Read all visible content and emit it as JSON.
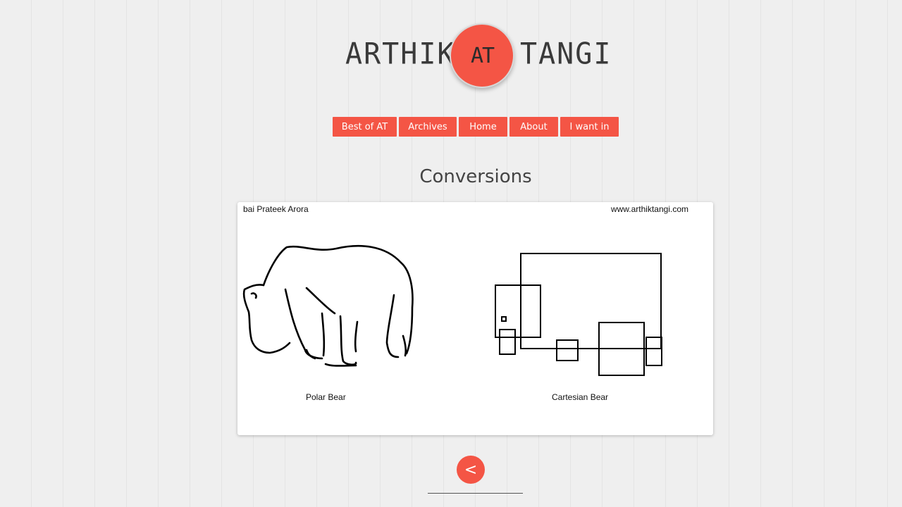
{
  "logo": {
    "left_word": "ARTHIK",
    "badge": "AT",
    "right_word": "TANGI"
  },
  "nav": {
    "items": [
      {
        "label": "Best of AT"
      },
      {
        "label": "Archives"
      },
      {
        "label": "Home"
      },
      {
        "label": "About"
      },
      {
        "label": "I want in"
      }
    ]
  },
  "post": {
    "title": "Conversions",
    "comic": {
      "author": "bai Prateek Arora",
      "site": "www.arthiktangi.com",
      "left_caption": "Polar Bear",
      "right_caption": "Cartesian Bear"
    }
  },
  "pagination": {
    "prev_label": "<"
  },
  "colors": {
    "accent": "#f45545",
    "background": "#efefef",
    "text": "#444444"
  }
}
